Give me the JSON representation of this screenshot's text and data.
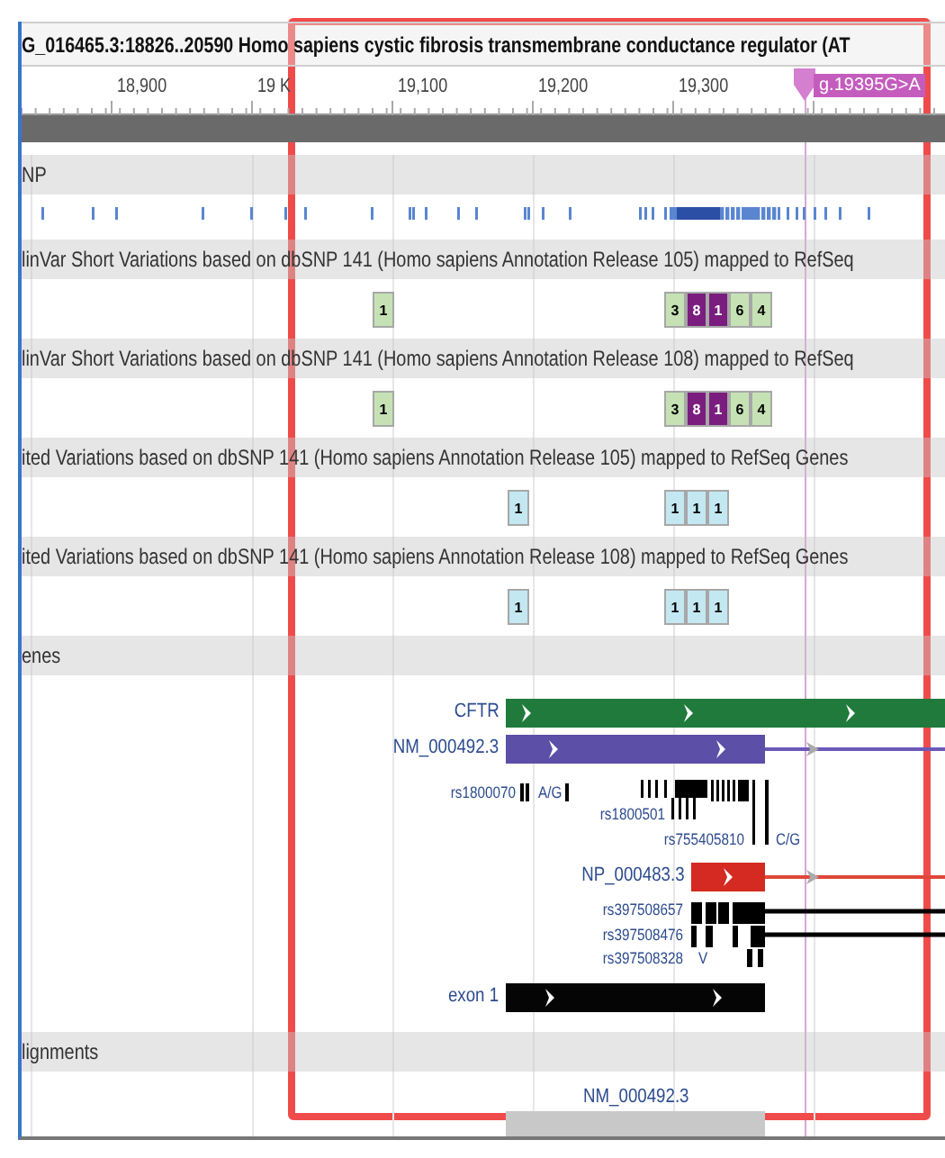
{
  "title": "G_016465.3:18826..20590 Homo sapiens cystic fibrosis transmembrane conductance regulator (AT",
  "ruler": {
    "ticks": [
      "18,900",
      "19 K",
      "19,100",
      "19,200",
      "19,300"
    ],
    "marker": "g.19395G>A"
  },
  "tracks": [
    {
      "kind": "snp",
      "label": "NP"
    },
    {
      "kind": "counts",
      "label": "linVar Short Variations based on dbSNP 141 (Homo sapiens Annotation Release 105) mapped to RefSeq",
      "groups": [
        {
          "boxes": [
            {
              "count": "1",
              "color": "#c6e2b4"
            }
          ]
        },
        {
          "boxes": [
            {
              "count": "3",
              "color": "#c6e2b4"
            },
            {
              "count": "8",
              "color": "#7a1d7f"
            },
            {
              "count": "1",
              "color": "#7a1d7f"
            },
            {
              "count": "6",
              "color": "#c6e2b4"
            },
            {
              "count": "4",
              "color": "#c6e2b4"
            }
          ]
        }
      ]
    },
    {
      "kind": "counts",
      "label": "linVar Short Variations based on dbSNP 141 (Homo sapiens Annotation Release 108) mapped to RefSeq",
      "groups": [
        {
          "boxes": [
            {
              "count": "1",
              "color": "#c6e2b4"
            }
          ]
        },
        {
          "boxes": [
            {
              "count": "3",
              "color": "#c6e2b4"
            },
            {
              "count": "8",
              "color": "#7a1d7f"
            },
            {
              "count": "1",
              "color": "#7a1d7f"
            },
            {
              "count": "6",
              "color": "#c6e2b4"
            },
            {
              "count": "4",
              "color": "#c6e2b4"
            }
          ]
        }
      ]
    },
    {
      "kind": "counts",
      "label": "ited Variations based on dbSNP 141 (Homo sapiens Annotation Release 105) mapped to RefSeq Genes",
      "groups": [
        {
          "boxes": [
            {
              "count": "1",
              "color": "#c4e8f2"
            }
          ]
        },
        {
          "boxes": [
            {
              "count": "1",
              "color": "#c4e8f2"
            },
            {
              "count": "1",
              "color": "#c4e8f2"
            },
            {
              "count": "1",
              "color": "#c4e8f2"
            }
          ]
        }
      ]
    },
    {
      "kind": "counts",
      "label": "ited Variations based on dbSNP 141 (Homo sapiens Annotation Release 108) mapped to RefSeq Genes",
      "groups": [
        {
          "boxes": [
            {
              "count": "1",
              "color": "#c4e8f2"
            }
          ]
        },
        {
          "boxes": [
            {
              "count": "1",
              "color": "#c4e8f2"
            },
            {
              "count": "1",
              "color": "#c4e8f2"
            },
            {
              "count": "1",
              "color": "#c4e8f2"
            }
          ]
        }
      ]
    },
    {
      "kind": "genes",
      "label": "enes",
      "gene": "CFTR",
      "transcript": "NM_000492.3",
      "variant_labels": [
        {
          "text": "rs1800070"
        },
        {
          "text": "A/G"
        },
        {
          "text": "rs1800501"
        },
        {
          "text": "rs755405810"
        },
        {
          "text": "C/G"
        }
      ],
      "protein": "NP_000483.3",
      "protein_variants": [
        {
          "text": "rs397508657"
        },
        {
          "text": "rs397508476"
        },
        {
          "text": "rs397508328"
        },
        {
          "text": "V"
        }
      ],
      "exon": "exon 1"
    },
    {
      "kind": "alignments",
      "label": "lignments",
      "alignment": "NM_000492.3"
    }
  ]
}
